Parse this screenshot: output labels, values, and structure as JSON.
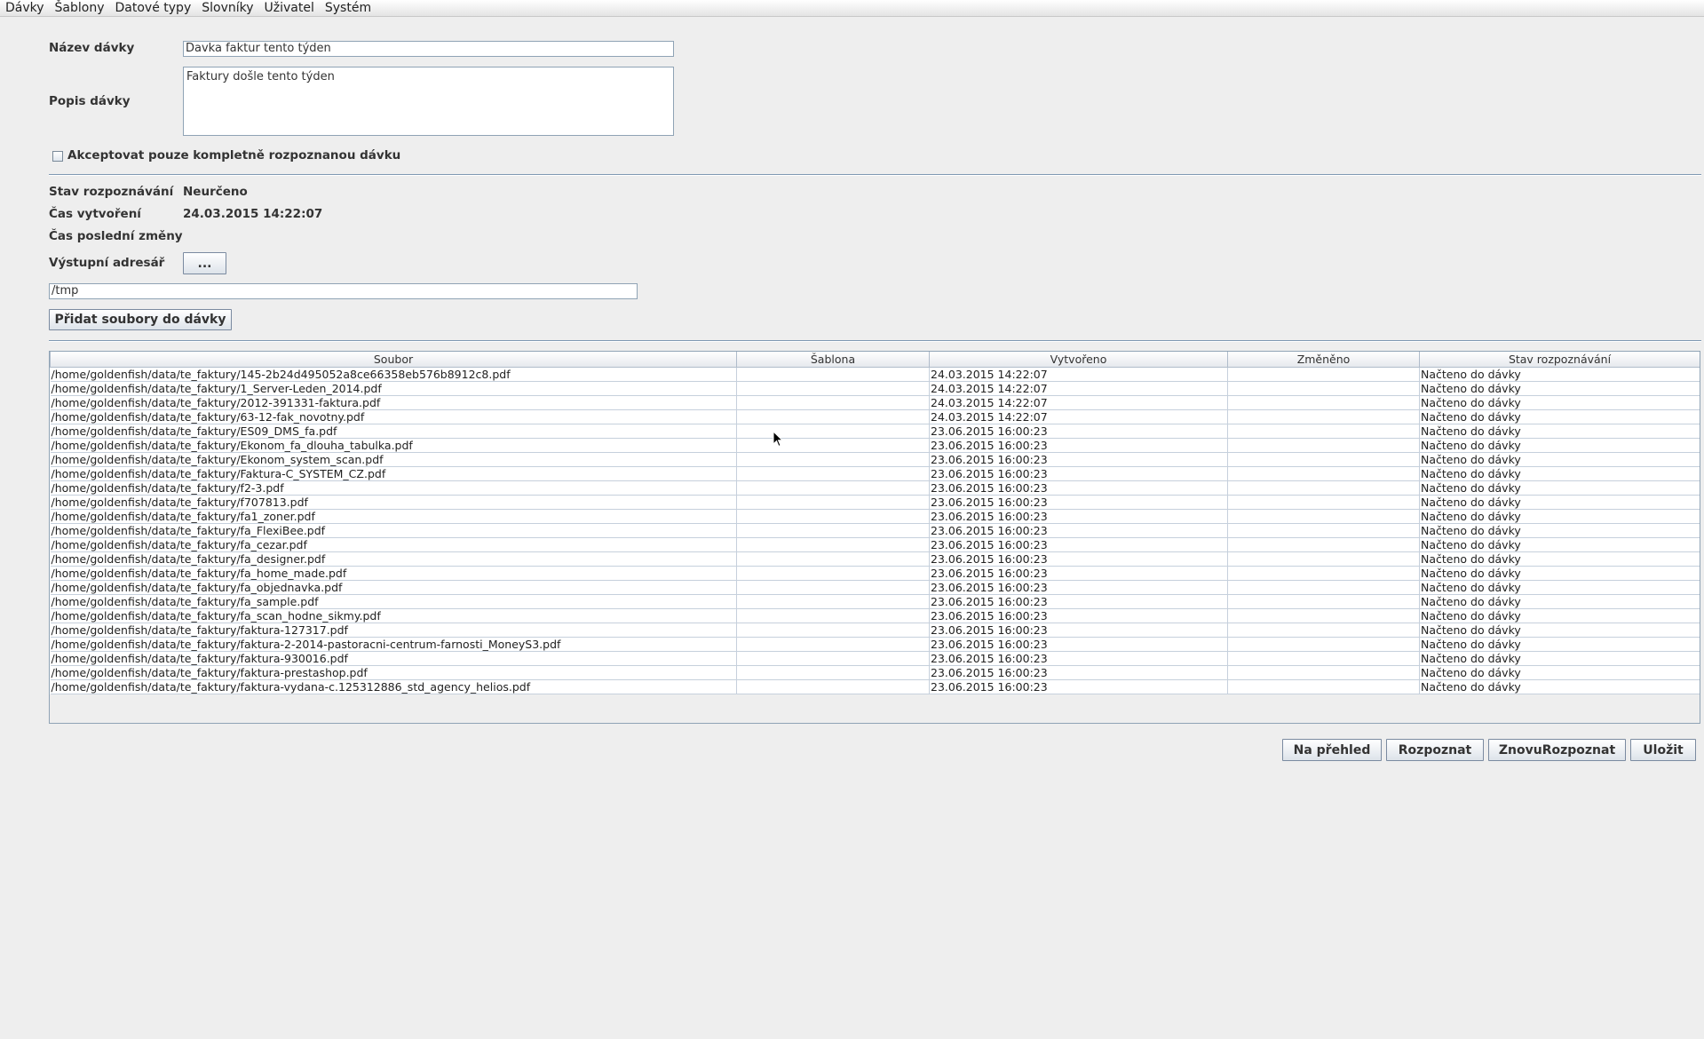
{
  "menu": [
    "Dávky",
    "Šablony",
    "Datové typy",
    "Slovníky",
    "Uživatel",
    "Systém"
  ],
  "form": {
    "name_label": "Název dávky",
    "name_value": "Davka faktur tento týden",
    "description_label": "Popis dávky",
    "description_value": "Faktury došle tento týden",
    "accept_checkbox_label": "Akceptovat pouze kompletně rozpoznanou dávku",
    "accept_checked": false
  },
  "info": {
    "status_label": "Stav rozpoznávání",
    "status_value": "Neurčeno",
    "created_label": "Čas vytvoření",
    "created_value": "24.03.2015 14:22:07",
    "modified_label": "Čas poslední změny",
    "modified_value": "",
    "output_dir_label": "Výstupní adresář",
    "browse_button_label": "...",
    "output_dir_value": "/tmp",
    "add_files_button_label": "Přidat soubory do dávky"
  },
  "table": {
    "columns": [
      "Soubor",
      "Šablona",
      "Vytvořeno",
      "Změněno",
      "Stav rozpoznávání"
    ],
    "rows": [
      [
        "/home/goldenfish/data/te_faktury/145-2b24d495052a8ce66358eb576b8912c8.pdf",
        "",
        "24.03.2015 14:22:07",
        "",
        "Načteno do dávky"
      ],
      [
        "/home/goldenfish/data/te_faktury/1_Server-Leden_2014.pdf",
        "",
        "24.03.2015 14:22:07",
        "",
        "Načteno do dávky"
      ],
      [
        "/home/goldenfish/data/te_faktury/2012-391331-faktura.pdf",
        "",
        "24.03.2015 14:22:07",
        "",
        "Načteno do dávky"
      ],
      [
        "/home/goldenfish/data/te_faktury/63-12-fak_novotny.pdf",
        "",
        "24.03.2015 14:22:07",
        "",
        "Načteno do dávky"
      ],
      [
        "/home/goldenfish/data/te_faktury/ES09_DMS_fa.pdf",
        "",
        "23.06.2015 16:00:23",
        "",
        "Načteno do dávky"
      ],
      [
        "/home/goldenfish/data/te_faktury/Ekonom_fa_dlouha_tabulka.pdf",
        "",
        "23.06.2015 16:00:23",
        "",
        "Načteno do dávky"
      ],
      [
        "/home/goldenfish/data/te_faktury/Ekonom_system_scan.pdf",
        "",
        "23.06.2015 16:00:23",
        "",
        "Načteno do dávky"
      ],
      [
        "/home/goldenfish/data/te_faktury/Faktura-C_SYSTEM_CZ.pdf",
        "",
        "23.06.2015 16:00:23",
        "",
        "Načteno do dávky"
      ],
      [
        "/home/goldenfish/data/te_faktury/f2-3.pdf",
        "",
        "23.06.2015 16:00:23",
        "",
        "Načteno do dávky"
      ],
      [
        "/home/goldenfish/data/te_faktury/f707813.pdf",
        "",
        "23.06.2015 16:00:23",
        "",
        "Načteno do dávky"
      ],
      [
        "/home/goldenfish/data/te_faktury/fa1_zoner.pdf",
        "",
        "23.06.2015 16:00:23",
        "",
        "Načteno do dávky"
      ],
      [
        "/home/goldenfish/data/te_faktury/fa_FlexiBee.pdf",
        "",
        "23.06.2015 16:00:23",
        "",
        "Načteno do dávky"
      ],
      [
        "/home/goldenfish/data/te_faktury/fa_cezar.pdf",
        "",
        "23.06.2015 16:00:23",
        "",
        "Načteno do dávky"
      ],
      [
        "/home/goldenfish/data/te_faktury/fa_designer.pdf",
        "",
        "23.06.2015 16:00:23",
        "",
        "Načteno do dávky"
      ],
      [
        "/home/goldenfish/data/te_faktury/fa_home_made.pdf",
        "",
        "23.06.2015 16:00:23",
        "",
        "Načteno do dávky"
      ],
      [
        "/home/goldenfish/data/te_faktury/fa_objednavka.pdf",
        "",
        "23.06.2015 16:00:23",
        "",
        "Načteno do dávky"
      ],
      [
        "/home/goldenfish/data/te_faktury/fa_sample.pdf",
        "",
        "23.06.2015 16:00:23",
        "",
        "Načteno do dávky"
      ],
      [
        "/home/goldenfish/data/te_faktury/fa_scan_hodne_sikmy.pdf",
        "",
        "23.06.2015 16:00:23",
        "",
        "Načteno do dávky"
      ],
      [
        "/home/goldenfish/data/te_faktury/faktura-127317.pdf",
        "",
        "23.06.2015 16:00:23",
        "",
        "Načteno do dávky"
      ],
      [
        "/home/goldenfish/data/te_faktury/faktura-2-2014-pastoracni-centrum-farnosti_MoneyS3.pdf",
        "",
        "23.06.2015 16:00:23",
        "",
        "Načteno do dávky"
      ],
      [
        "/home/goldenfish/data/te_faktury/faktura-930016.pdf",
        "",
        "23.06.2015 16:00:23",
        "",
        "Načteno do dávky"
      ],
      [
        "/home/goldenfish/data/te_faktury/faktura-prestashop.pdf",
        "",
        "23.06.2015 16:00:23",
        "",
        "Načteno do dávky"
      ],
      [
        "/home/goldenfish/data/te_faktury/faktura-vydana-c.125312886_std_agency_helios.pdf",
        "",
        "23.06.2015 16:00:23",
        "",
        "Načteno do dávky"
      ]
    ]
  },
  "actions": {
    "overview_label": "Na přehled",
    "recognize_label": "Rozpoznat",
    "rerecognize_label": "ZnovuRozpoznat",
    "save_label": "Uložit"
  }
}
